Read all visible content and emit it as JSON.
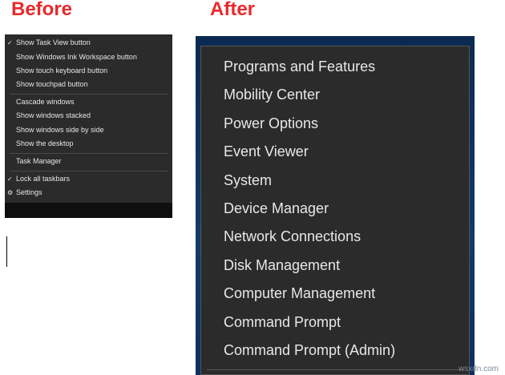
{
  "headings": {
    "before": "Before",
    "after": "After"
  },
  "before_menu": {
    "items": [
      {
        "label": "Show Task View button",
        "mark": "✓"
      },
      {
        "label": "Show Windows Ink Workspace button",
        "mark": ""
      },
      {
        "label": "Show touch keyboard button",
        "mark": ""
      },
      {
        "label": "Show touchpad button",
        "mark": ""
      },
      {
        "label": "Cascade windows",
        "mark": ""
      },
      {
        "label": "Show windows stacked",
        "mark": ""
      },
      {
        "label": "Show windows side by side",
        "mark": ""
      },
      {
        "label": "Show the desktop",
        "mark": ""
      },
      {
        "label": "Task Manager",
        "mark": ""
      },
      {
        "label": "Lock all taskbars",
        "mark": "✓"
      },
      {
        "label": "Settings",
        "mark": "⚙"
      }
    ]
  },
  "after_menu": {
    "items": [
      "Programs and Features",
      "Mobility Center",
      "Power Options",
      "Event Viewer",
      "System",
      "Device Manager",
      "Network Connections",
      "Disk Management",
      "Computer Management",
      "Command Prompt",
      "Command Prompt (Admin)"
    ]
  },
  "watermark": "wsxdn.com",
  "icons": {
    "check": "check-icon",
    "settings": "gear-icon"
  },
  "colors": {
    "heading": "#e8292b",
    "menu_bg": "#2b2b2b",
    "menu_text": "#e6e6e6"
  }
}
